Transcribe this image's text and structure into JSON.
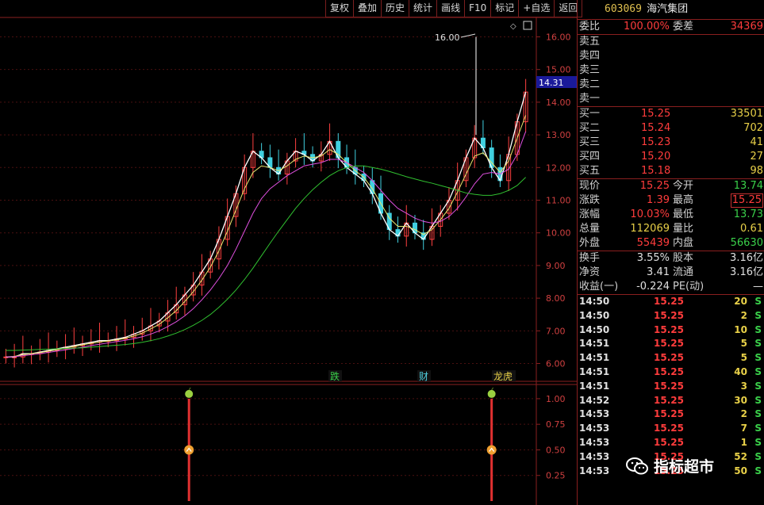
{
  "toolbar": [
    "复权",
    "叠加",
    "历史",
    "统计",
    "画线",
    "F10",
    "标记",
    "+自选",
    "返回"
  ],
  "stock": {
    "code": "603069",
    "name": "海汽集团"
  },
  "header_row": {
    "l1": "委比",
    "v1": "100.00%",
    "l2": "委差",
    "v2": "34369"
  },
  "asks": [
    {
      "label": "卖五",
      "price": "",
      "vol": ""
    },
    {
      "label": "卖四",
      "price": "",
      "vol": ""
    },
    {
      "label": "卖三",
      "price": "",
      "vol": ""
    },
    {
      "label": "卖二",
      "price": "",
      "vol": ""
    },
    {
      "label": "卖一",
      "price": "",
      "vol": ""
    }
  ],
  "bids": [
    {
      "label": "买一",
      "price": "15.25",
      "vol": "33501"
    },
    {
      "label": "买二",
      "price": "15.24",
      "vol": "702"
    },
    {
      "label": "买三",
      "price": "15.23",
      "vol": "41"
    },
    {
      "label": "买四",
      "price": "15.20",
      "vol": "27"
    },
    {
      "label": "买五",
      "price": "15.18",
      "vol": "98"
    }
  ],
  "quote": [
    {
      "l1": "现价",
      "v1": "15.25",
      "c1": "red",
      "l2": "今开",
      "v2": "13.74",
      "c2": "grn"
    },
    {
      "l1": "涨跌",
      "v1": "1.39",
      "c1": "red",
      "l2": "最高",
      "v2": "15.25",
      "c2": "red",
      "box": true
    },
    {
      "l1": "涨幅",
      "v1": "10.03%",
      "c1": "red",
      "l2": "最低",
      "v2": "13.73",
      "c2": "grn"
    },
    {
      "l1": "总量",
      "v1": "112069",
      "c1": "yel",
      "l2": "量比",
      "v2": "0.61",
      "c2": "yel"
    },
    {
      "l1": "外盘",
      "v1": "55439",
      "c1": "red",
      "l2": "内盘",
      "v2": "56630",
      "c2": "grn"
    }
  ],
  "fundamentals": [
    {
      "l1": "换手",
      "v1": "3.55%",
      "l2": "股本",
      "v2": "3.16亿"
    },
    {
      "l1": "净资",
      "v1": "3.41",
      "l2": "流通",
      "v2": "3.16亿"
    },
    {
      "l1": "收益(一)",
      "v1": "-0.224",
      "l2": "PE(动)",
      "v2": "—"
    }
  ],
  "ticks": [
    {
      "time": "14:50",
      "price": "15.25",
      "vol": "20",
      "side": "S"
    },
    {
      "time": "14:50",
      "price": "15.25",
      "vol": "2",
      "side": "S"
    },
    {
      "time": "14:50",
      "price": "15.25",
      "vol": "10",
      "side": "S"
    },
    {
      "time": "14:51",
      "price": "15.25",
      "vol": "5",
      "side": "S"
    },
    {
      "time": "14:51",
      "price": "15.25",
      "vol": "5",
      "side": "S"
    },
    {
      "time": "14:51",
      "price": "15.25",
      "vol": "40",
      "side": "S"
    },
    {
      "time": "14:51",
      "price": "15.25",
      "vol": "3",
      "side": "S"
    },
    {
      "time": "14:52",
      "price": "15.25",
      "vol": "30",
      "side": "S"
    },
    {
      "time": "14:53",
      "price": "15.25",
      "vol": "2",
      "side": "S"
    },
    {
      "time": "14:53",
      "price": "15.25",
      "vol": "7",
      "side": "S"
    },
    {
      "time": "14:53",
      "price": "15.25",
      "vol": "1",
      "side": "S"
    },
    {
      "time": "14:53",
      "price": "15.25",
      "vol": "52",
      "side": "S"
    },
    {
      "time": "14:53",
      "price": "15.25",
      "vol": "50",
      "side": "S"
    }
  ],
  "watermark": "指标超市",
  "chart_data": {
    "type": "line",
    "title": "",
    "ylim": [
      5.6,
      16.4
    ],
    "yticks": [
      "16.00",
      "15.00",
      "14.00",
      "13.00",
      "12.00",
      "11.00",
      "10.00",
      "9.00",
      "8.00",
      "7.00",
      "6.00"
    ],
    "current_price_label": "14.31",
    "current_price": 14.31,
    "high_annotation": {
      "label": "16.00",
      "value": 16.0
    },
    "event_markers": [
      {
        "label": "跌",
        "color": "#3ad04a"
      },
      {
        "label": "财",
        "color": "#50d0e0"
      },
      {
        "label": "龙虎",
        "color": "#e8d048"
      }
    ],
    "series": [
      {
        "values": [
          6.2,
          6.2,
          6.3,
          6.3,
          6.35,
          6.4,
          6.45,
          6.5,
          6.55,
          6.6,
          6.65,
          6.7,
          6.7,
          6.75,
          6.8,
          6.9,
          7.0,
          7.15,
          7.3,
          7.55,
          7.8,
          8.1,
          8.4,
          8.8,
          9.2,
          9.8,
          10.5,
          11.2,
          12.0,
          12.5,
          12.3,
          12.0,
          11.8,
          12.2,
          12.5,
          12.4,
          12.2,
          12.4,
          12.8,
          12.3,
          12.0,
          11.8,
          11.6,
          11.2,
          10.6,
          10.1,
          9.9,
          10.3,
          10.0,
          9.8,
          10.2,
          10.6,
          11.0,
          11.6,
          12.3,
          12.9,
          12.6,
          12.0,
          11.6,
          12.4,
          13.4,
          14.31
        ]
      },
      {
        "values": [
          6.2,
          6.22,
          6.27,
          6.3,
          6.33,
          6.38,
          6.42,
          6.47,
          6.52,
          6.57,
          6.62,
          6.66,
          6.69,
          6.72,
          6.77,
          6.84,
          6.93,
          7.06,
          7.2,
          7.4,
          7.62,
          7.9,
          8.2,
          8.55,
          8.95,
          9.45,
          10.05,
          10.7,
          11.35,
          11.85,
          12.05,
          12.0,
          11.9,
          12.05,
          12.25,
          12.35,
          12.3,
          12.35,
          12.55,
          12.4,
          12.15,
          11.9,
          11.7,
          11.35,
          10.9,
          10.45,
          10.2,
          10.2,
          10.1,
          9.95,
          10.1,
          10.4,
          10.75,
          11.25,
          11.8,
          12.35,
          12.45,
          12.15,
          11.85,
          12.2,
          12.9,
          13.6
        ]
      },
      {
        "values": [
          6.2,
          6.21,
          6.24,
          6.27,
          6.3,
          6.34,
          6.38,
          6.42,
          6.46,
          6.5,
          6.55,
          6.59,
          6.63,
          6.67,
          6.71,
          6.76,
          6.82,
          6.9,
          7.0,
          7.13,
          7.28,
          7.46,
          7.68,
          7.95,
          8.25,
          8.6,
          9.0,
          9.5,
          10.05,
          10.6,
          11.05,
          11.35,
          11.55,
          11.75,
          11.9,
          12.05,
          12.1,
          12.15,
          12.25,
          12.25,
          12.15,
          12.0,
          11.85,
          11.6,
          11.3,
          11.0,
          10.75,
          10.6,
          10.45,
          10.35,
          10.3,
          10.35,
          10.5,
          10.75,
          11.1,
          11.5,
          11.8,
          11.85,
          11.8,
          11.95,
          12.4,
          13.1
        ]
      },
      {
        "values": [
          6.4,
          6.4,
          6.41,
          6.42,
          6.43,
          6.44,
          6.45,
          6.46,
          6.47,
          6.48,
          6.5,
          6.52,
          6.54,
          6.56,
          6.58,
          6.61,
          6.65,
          6.7,
          6.76,
          6.84,
          6.93,
          7.04,
          7.17,
          7.32,
          7.5,
          7.72,
          7.97,
          8.25,
          8.57,
          8.92,
          9.3,
          9.68,
          10.05,
          10.4,
          10.75,
          11.05,
          11.32,
          11.55,
          11.75,
          11.9,
          12.0,
          12.05,
          12.05,
          12.0,
          11.95,
          11.88,
          11.8,
          11.72,
          11.65,
          11.58,
          11.52,
          11.45,
          11.38,
          11.3,
          11.22,
          11.18,
          11.15,
          11.15,
          11.2,
          11.3,
          11.45,
          11.7
        ]
      }
    ],
    "indicator": {
      "yticks": [
        "1.00",
        "0.75",
        "0.50",
        "0.25"
      ],
      "ylim": [
        0,
        1.1
      ],
      "signals": [
        {
          "index": 20,
          "value": 1.0
        },
        {
          "index": 57,
          "value": 1.0
        }
      ]
    }
  }
}
